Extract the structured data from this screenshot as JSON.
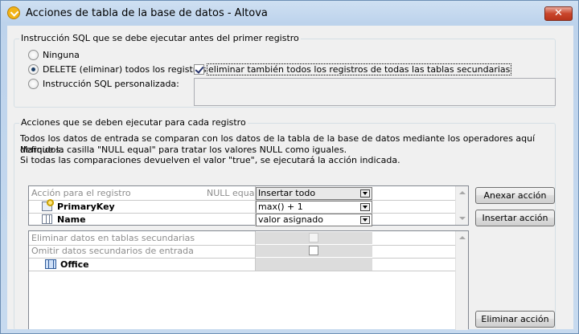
{
  "window": {
    "title": "Acciones de tabla de la base de datos - Altova",
    "close_glyph": "✕"
  },
  "sql_group": {
    "title": "Instrucción SQL que se debe ejecutar antes del primer registro",
    "option_none": "Ninguna",
    "option_delete": "DELETE (eliminar) todos los registros",
    "option_custom": "Instrucción SQL personalizada:",
    "delete_children_label": "eliminar también todos los registros de todas las tablas secundarias",
    "delete_children_checked": true,
    "selected_option": "delete",
    "custom_sql_value": ""
  },
  "actions_group": {
    "title": "Acciones que se deben ejecutar para cada registro",
    "desc_line1": "Todos los datos de entrada se comparan con los datos de la tabla de la base de datos mediante los operadores aquí definidos.",
    "desc_line2": "Marque la casilla \"NULL equal\" para tratar los valores NULL como iguales.",
    "desc_line3": "Si todas las comparaciones devuelven el valor \"true\", se ejecutará la acción indicada."
  },
  "grid": {
    "header_action_label": "Acción para el registro",
    "header_null_equal": "NULL equal",
    "header_action_value": "Insertar todo",
    "rows": [
      {
        "name": "PrimaryKey",
        "value": "max() + 1",
        "icon": "primary-key-icon"
      },
      {
        "name": "Name",
        "value": "valor asignado",
        "icon": "column-icon"
      }
    ]
  },
  "lower_grid": {
    "delete_children_label": "Eliminar datos en tablas secundarias",
    "skip_input_label": "Omitir datos secundarios de entrada",
    "child_table": "Office"
  },
  "buttons": {
    "append": "Anexar acción",
    "insert": "Insertar acción",
    "delete": "Eliminar acción"
  },
  "colors": {
    "title_bg": "#bdd3ec",
    "client_bg": "#f0f0f0",
    "close_red": "#c9452b"
  }
}
